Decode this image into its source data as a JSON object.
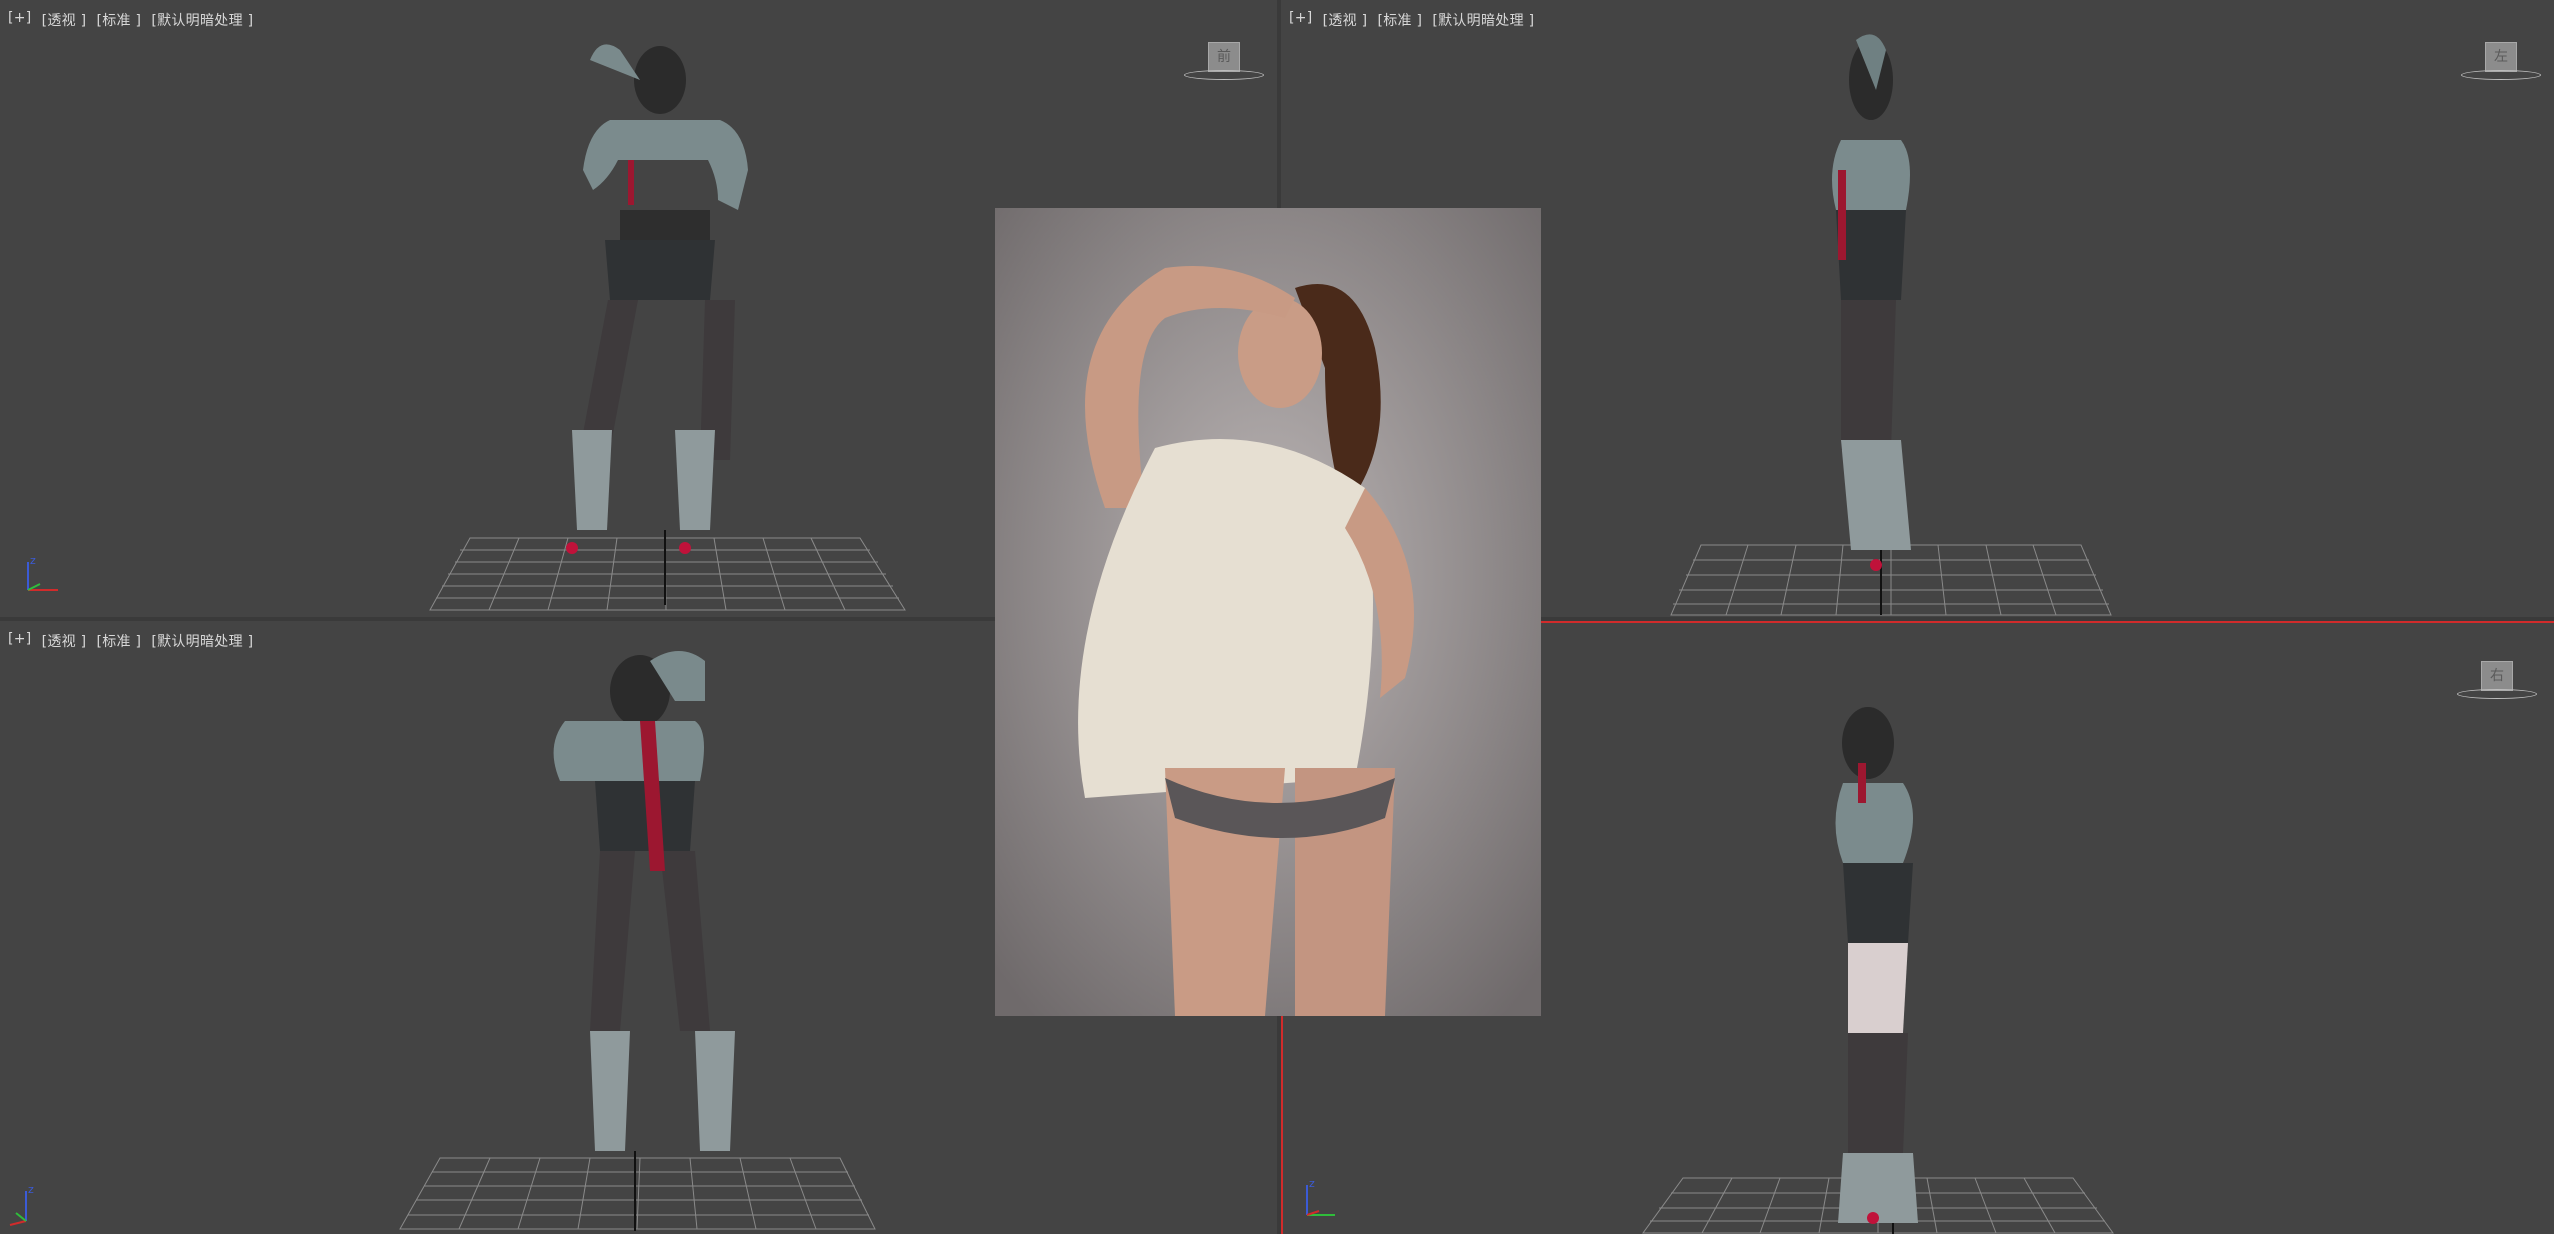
{
  "viewports": [
    {
      "id": "top-left",
      "labels": [
        "[+]",
        "[透视 ]",
        "[标准 ]",
        "[默认明暗处理 ]"
      ],
      "viewcube_label": "前"
    },
    {
      "id": "top-right",
      "labels": [
        "[+]",
        "[透视 ]",
        "[标准 ]",
        "[默认明暗处理 ]"
      ],
      "viewcube_label": "左"
    },
    {
      "id": "bottom-left",
      "labels": [
        "[+]",
        "[透视 ]",
        "[标准 ]",
        "[默认明暗处理 ]"
      ],
      "viewcube_label": ""
    },
    {
      "id": "bottom-right",
      "labels": [],
      "viewcube_label": "右"
    }
  ],
  "axis_labels": {
    "z": "z",
    "x": "x",
    "y": "y"
  },
  "colors": {
    "viewport_bg": "#444444",
    "active_border": "#d12b2b",
    "grid": "#8a8a8a",
    "label_text": "#d8d8d8"
  },
  "icons": [
    "viewcube-icon",
    "axis-gizmo-icon"
  ]
}
